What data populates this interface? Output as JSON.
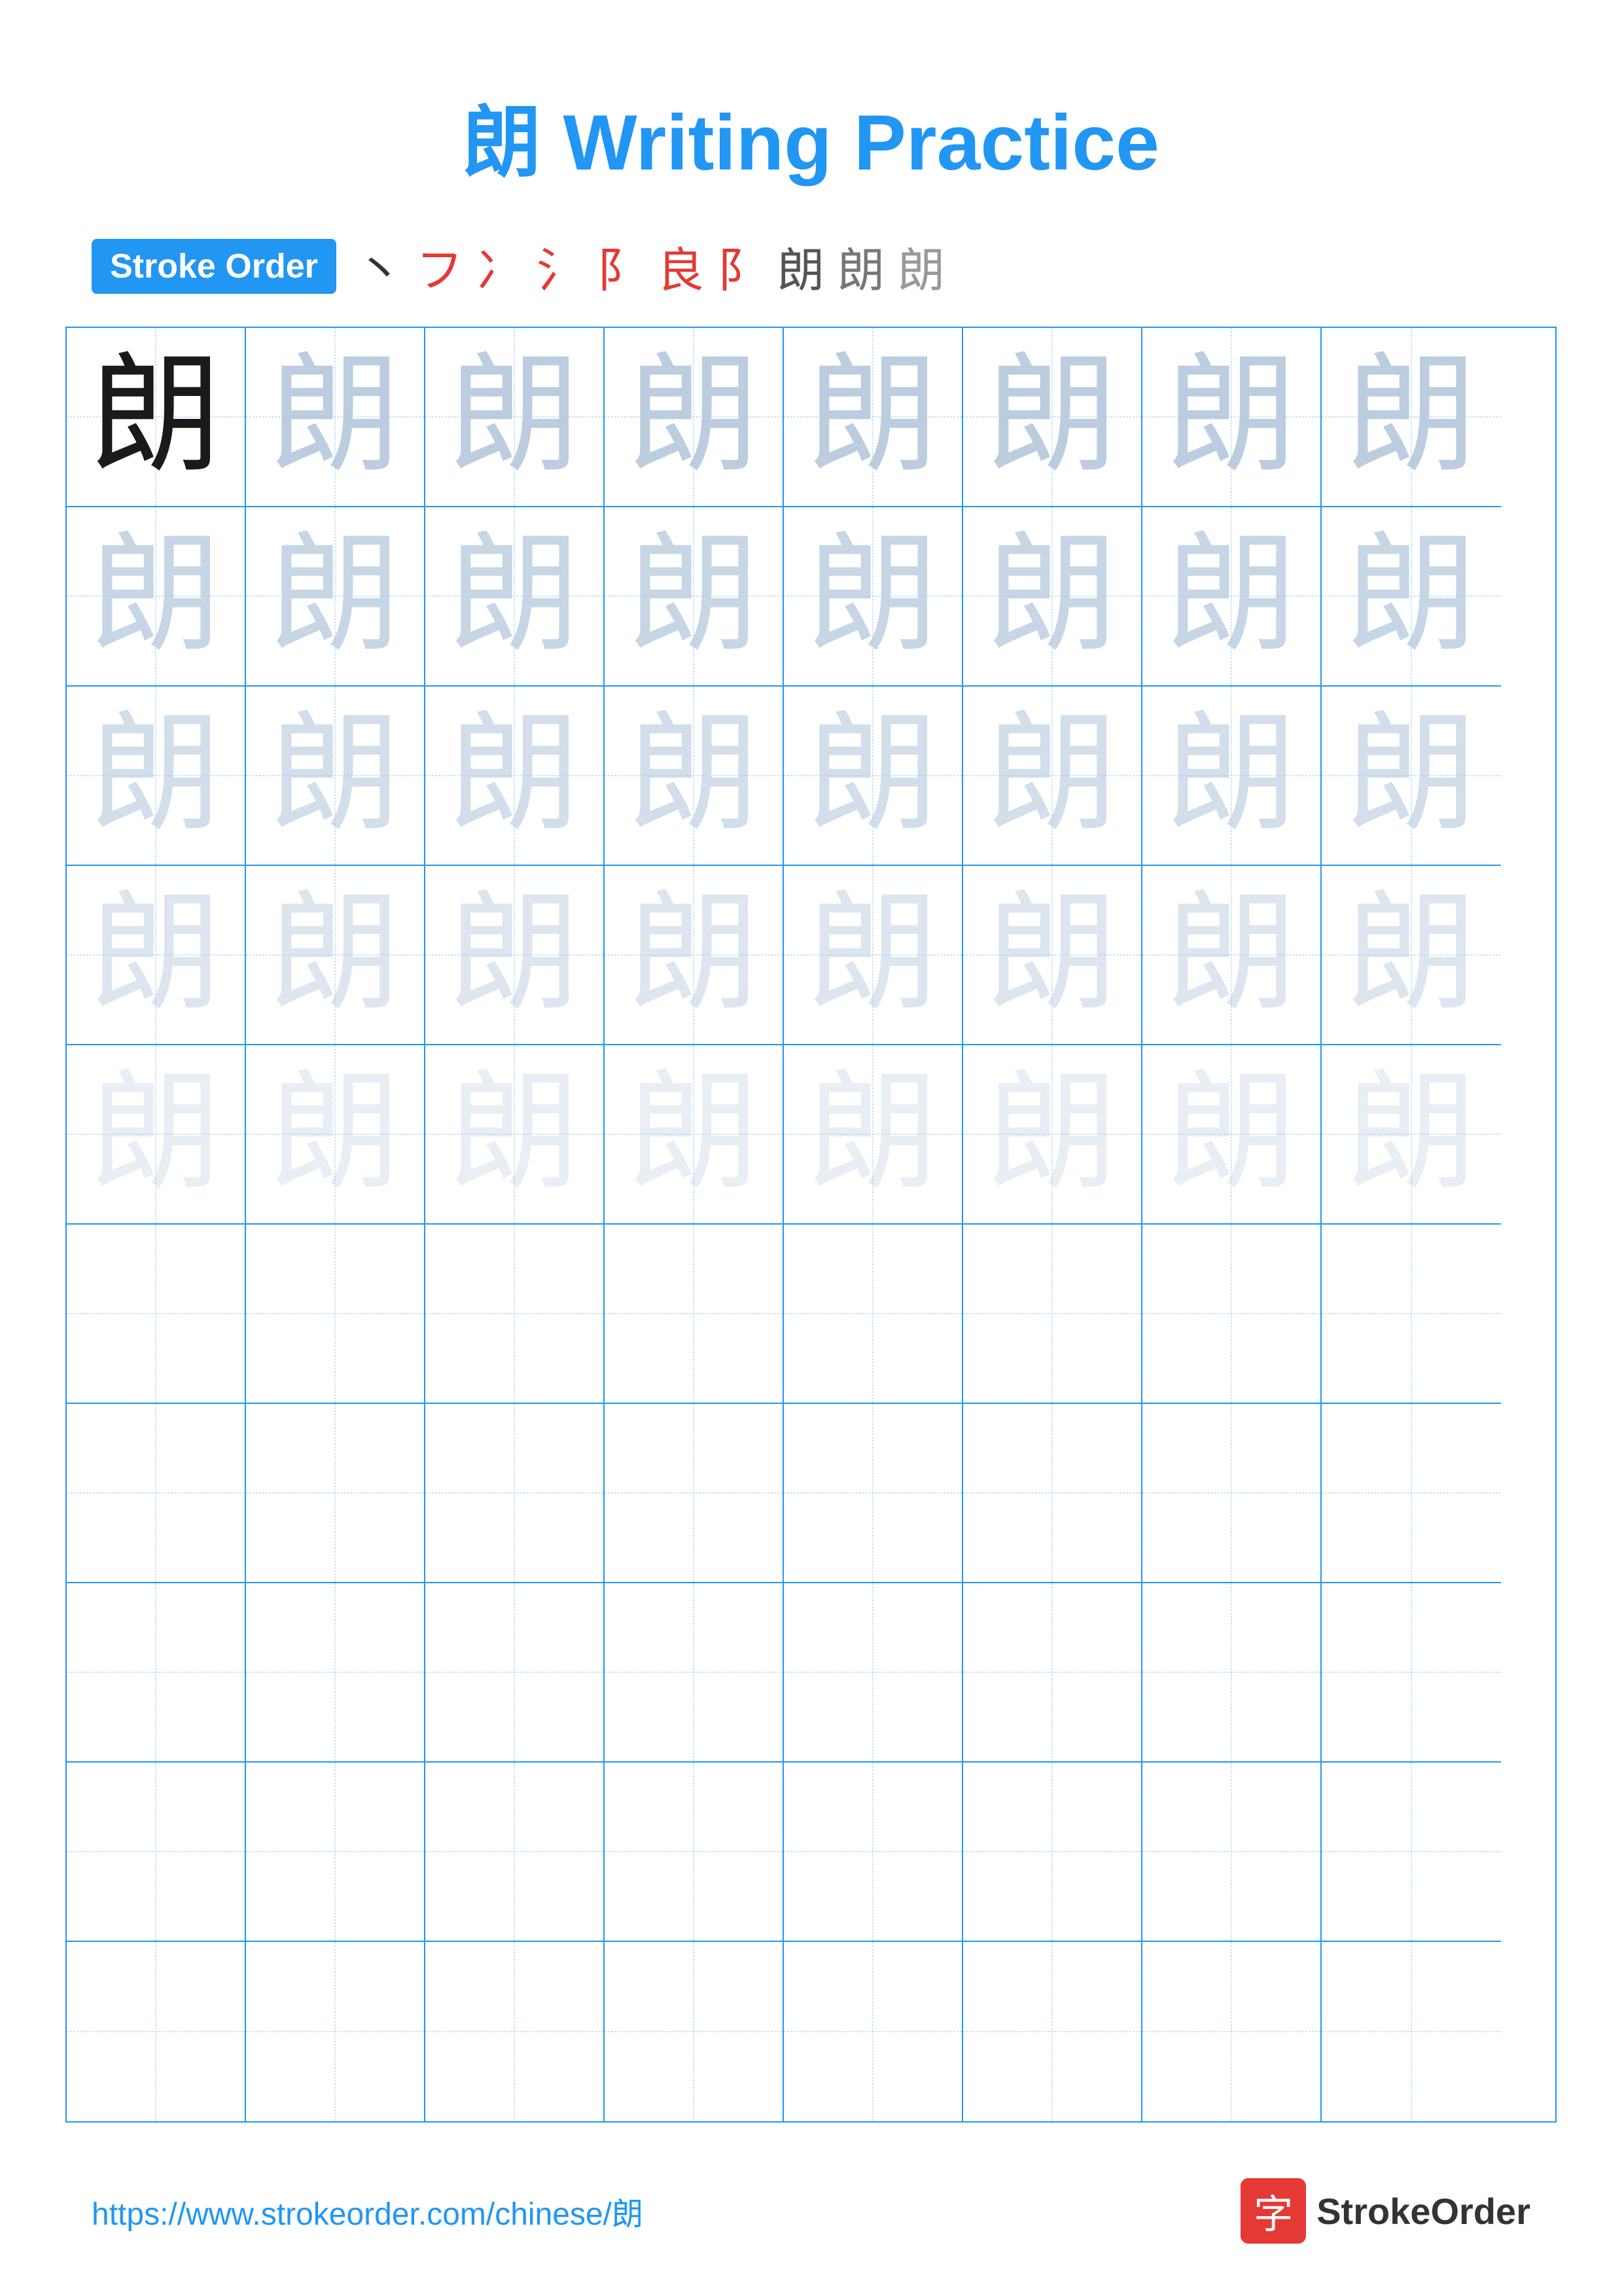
{
  "title": "朗 Writing Practice",
  "stroke_order": {
    "badge_label": "Stroke Order",
    "strokes": [
      "丶",
      "フ",
      "冫",
      "氵",
      "β",
      "良",
      "阝",
      "朗",
      "朗",
      "朗"
    ]
  },
  "character": "朗",
  "grid": {
    "cols": 8,
    "practice_rows": 5,
    "empty_rows": 5
  },
  "footer": {
    "url": "https://www.strokeorder.com/chinese/朗",
    "brand": "StrokeOrder"
  }
}
